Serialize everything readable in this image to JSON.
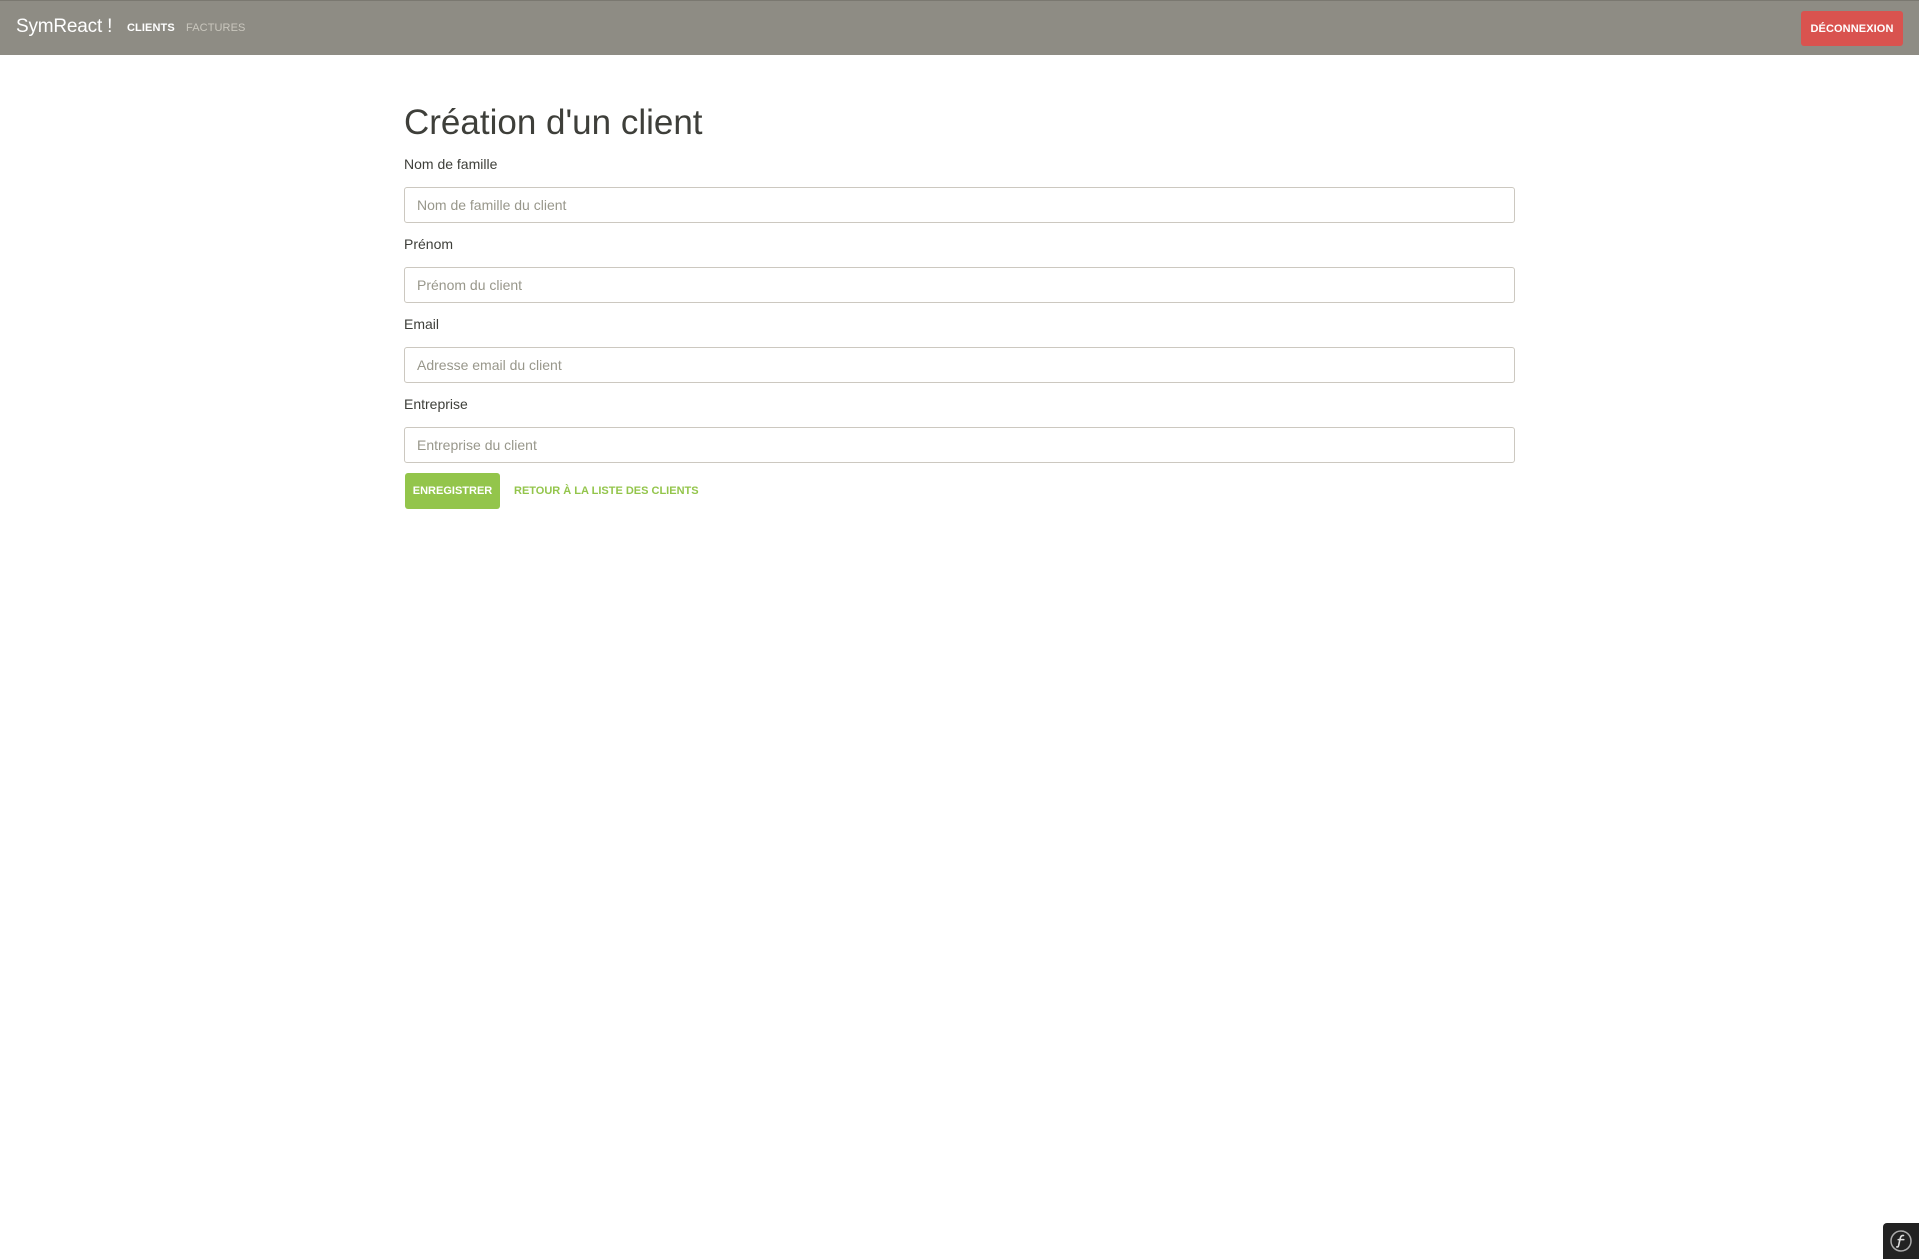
{
  "navbar": {
    "brand": "SymReact !",
    "links": [
      {
        "label": "Clients",
        "active": true
      },
      {
        "label": "Factures",
        "active": false
      }
    ],
    "logout_label": "Déconnexion"
  },
  "page": {
    "title": "Création d'un client"
  },
  "form": {
    "fields": [
      {
        "label": "Nom de famille",
        "placeholder": "Nom de famille du client",
        "value": ""
      },
      {
        "label": "Prénom",
        "placeholder": "Prénom du client",
        "value": ""
      },
      {
        "label": "Email",
        "placeholder": "Adresse email du client",
        "value": ""
      },
      {
        "label": "Entreprise",
        "placeholder": "Entreprise du client",
        "value": ""
      }
    ],
    "save_label": "Enregistrer",
    "back_label": "Retour à la liste des clients"
  },
  "colors": {
    "navbar": "#8e8c84",
    "danger": "#d9534f",
    "success": "#93c54b"
  },
  "icons": {
    "debug_toolbar": "symfony-logo-icon"
  }
}
